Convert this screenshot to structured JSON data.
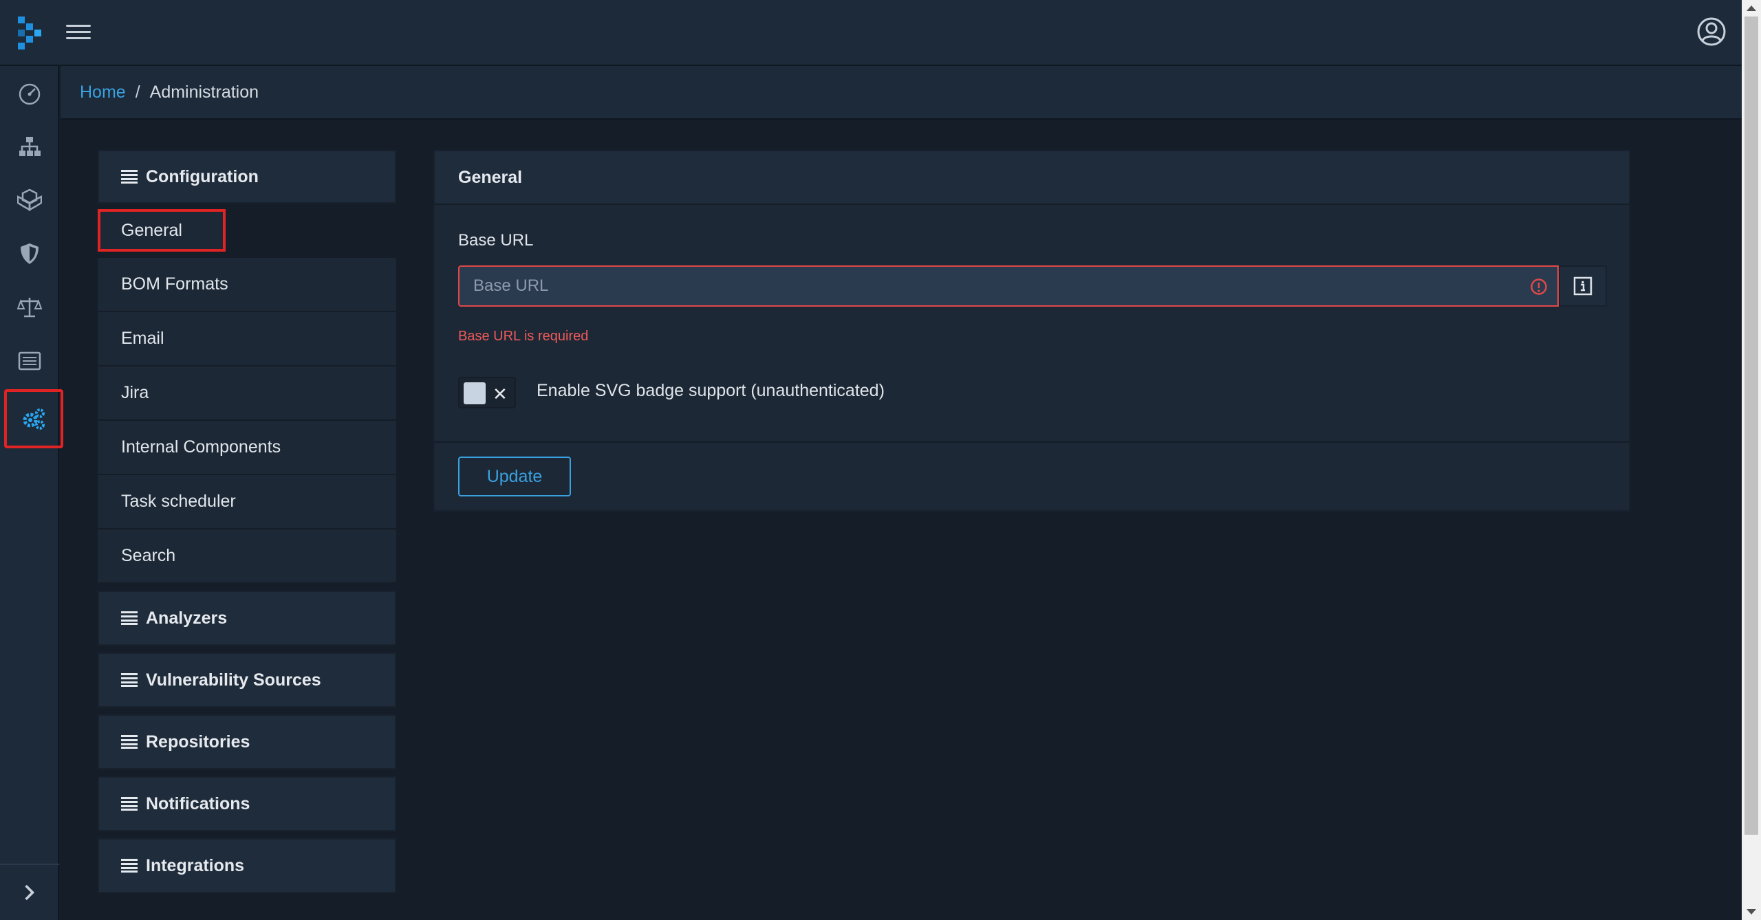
{
  "header": {
    "logo_icon": "dependency-track-logo-icon",
    "menu_icon": "hamburger-icon",
    "user_icon": "user-circle-icon"
  },
  "sidebar": {
    "items": [
      {
        "icon": "dashboard-gauge-icon"
      },
      {
        "icon": "hierarchy-icon"
      },
      {
        "icon": "cubes-icon"
      },
      {
        "icon": "shield-icon"
      },
      {
        "icon": "balance-scale-icon"
      },
      {
        "icon": "list-alt-icon"
      },
      {
        "icon": "cogs-icon",
        "active": true
      }
    ],
    "footer_icon": "chevron-right-icon"
  },
  "breadcrumb": {
    "home": "Home",
    "separator": "/",
    "current": "Administration"
  },
  "menu": {
    "configuration": {
      "title": "Configuration",
      "items": [
        "General",
        "BOM Formats",
        "Email",
        "Jira",
        "Internal Components",
        "Task scheduler",
        "Search"
      ]
    },
    "groups": [
      "Analyzers",
      "Vulnerability Sources",
      "Repositories",
      "Notifications",
      "Integrations"
    ]
  },
  "general": {
    "title": "General",
    "base_url_label": "Base URL",
    "base_url_placeholder": "Base URL",
    "base_url_value": "",
    "base_url_error": "Base URL is required",
    "svg_badge_label": "Enable SVG badge support (unauthenticated)",
    "svg_badge_enabled": false,
    "update_label": "Update"
  },
  "colors": {
    "accent": "#3aa1e0",
    "error": "#e02424",
    "background": "#141d28",
    "panel": "#1c2a3a"
  }
}
